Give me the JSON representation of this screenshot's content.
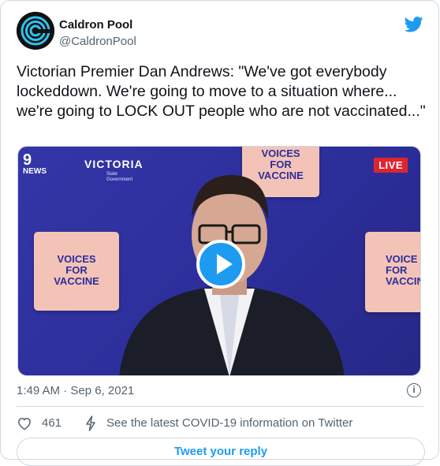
{
  "account": {
    "display_name": "Caldron Pool",
    "handle": "@CaldronPool",
    "avatar_icon": "caldron-pool-logo"
  },
  "tweet": {
    "text": "Victorian Premier Dan Andrews: \"We've got everybody lockeddown. We're going to move to a situation where... we're going to LOCK OUT people who are not vaccinated...\"",
    "timestamp": "1:49 AM · Sep 6, 2021"
  },
  "media": {
    "channel_number": "9",
    "channel_label": "NEWS",
    "government_logo": "VICTORIA",
    "government_sub_1": "State",
    "government_sub_2": "Government",
    "live_badge": "LIVE",
    "sign_line_1": "VOICES",
    "sign_line_2": "FOR",
    "sign_line_3": "VACCINE",
    "right_sign_line_1": "VOICE",
    "right_sign_line_2": "FOR",
    "right_sign_line_3": "VACCIN"
  },
  "actions": {
    "like_count": "461",
    "covid_info": "See the latest COVID-19 information on Twitter",
    "info_glyph": "i"
  },
  "reply_button": "Tweet your reply",
  "colors": {
    "accent": "#1d9bf0",
    "live_red": "#e0242e",
    "backdrop_blue": "#2c2e9a",
    "sign_pink": "#f4c3b8"
  }
}
